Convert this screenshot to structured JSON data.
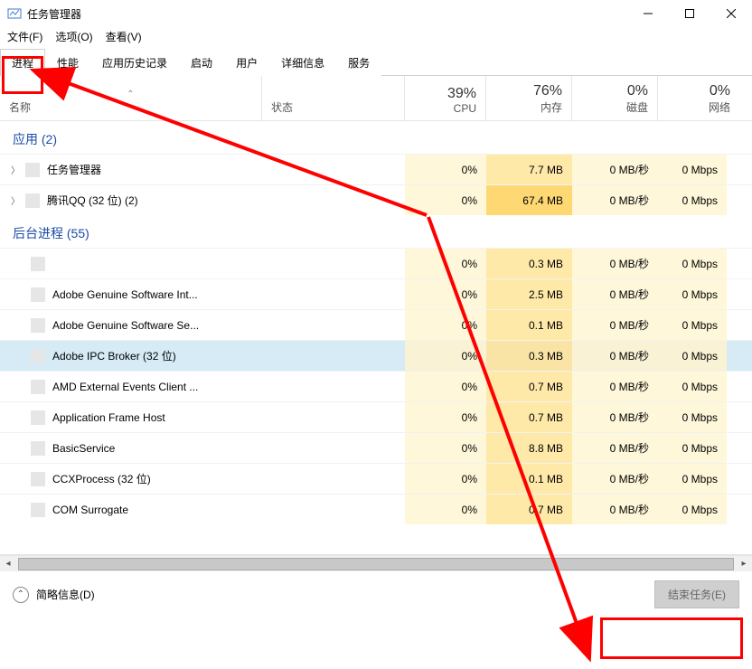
{
  "window": {
    "title": "任务管理器"
  },
  "menu": {
    "file": "文件(F)",
    "options": "选项(O)",
    "view": "查看(V)"
  },
  "tabs": [
    {
      "label": "进程",
      "active": true
    },
    {
      "label": "性能",
      "active": false
    },
    {
      "label": "应用历史记录",
      "active": false
    },
    {
      "label": "启动",
      "active": false
    },
    {
      "label": "用户",
      "active": false
    },
    {
      "label": "详细信息",
      "active": false
    },
    {
      "label": "服务",
      "active": false
    }
  ],
  "columns": {
    "name": "名称",
    "state": "状态",
    "cpu_pct": "39%",
    "cpu_lbl": "CPU",
    "mem_pct": "76%",
    "mem_lbl": "内存",
    "dsk_pct": "0%",
    "dsk_lbl": "磁盘",
    "net_pct": "0%",
    "net_lbl": "网络"
  },
  "groups": {
    "apps": "应用 (2)",
    "bg": "后台进程 (55)"
  },
  "rows": {
    "r0": {
      "name": "任务管理器",
      "cpu": "0%",
      "mem": "7.7 MB",
      "dsk": "0 MB/秒",
      "net": "0 Mbps",
      "exp": true,
      "memdark": false
    },
    "r1": {
      "name": "腾讯QQ (32 位) (2)",
      "cpu": "0%",
      "mem": "67.4 MB",
      "dsk": "0 MB/秒",
      "net": "0 Mbps",
      "exp": true,
      "memdark": true
    },
    "r2": {
      "name": "",
      "cpu": "0%",
      "mem": "0.3 MB",
      "dsk": "0 MB/秒",
      "net": "0 Mbps",
      "exp": false,
      "memdark": false
    },
    "r3": {
      "name": "Adobe Genuine Software Int...",
      "cpu": "0%",
      "mem": "2.5 MB",
      "dsk": "0 MB/秒",
      "net": "0 Mbps",
      "exp": false,
      "memdark": false
    },
    "r4": {
      "name": "Adobe Genuine Software Se...",
      "cpu": "0%",
      "mem": "0.1 MB",
      "dsk": "0 MB/秒",
      "net": "0 Mbps",
      "exp": false,
      "memdark": false
    },
    "r5": {
      "name": "Adobe IPC Broker (32 位)",
      "cpu": "0%",
      "mem": "0.3 MB",
      "dsk": "0 MB/秒",
      "net": "0 Mbps",
      "exp": false,
      "memdark": false,
      "selected": true
    },
    "r6": {
      "name": "AMD External Events Client ...",
      "cpu": "0%",
      "mem": "0.7 MB",
      "dsk": "0 MB/秒",
      "net": "0 Mbps",
      "exp": false,
      "memdark": false
    },
    "r7": {
      "name": "Application Frame Host",
      "cpu": "0%",
      "mem": "0.7 MB",
      "dsk": "0 MB/秒",
      "net": "0 Mbps",
      "exp": false,
      "memdark": false
    },
    "r8": {
      "name": "BasicService",
      "cpu": "0%",
      "mem": "8.8 MB",
      "dsk": "0 MB/秒",
      "net": "0 Mbps",
      "exp": false,
      "memdark": false
    },
    "r9": {
      "name": "CCXProcess (32 位)",
      "cpu": "0%",
      "mem": "0.1 MB",
      "dsk": "0 MB/秒",
      "net": "0 Mbps",
      "exp": false,
      "memdark": false
    },
    "r10": {
      "name": "COM Surrogate",
      "cpu": "0%",
      "mem": "0.7 MB",
      "dsk": "0 MB/秒",
      "net": "0 Mbps",
      "exp": false,
      "memdark": false
    }
  },
  "footer": {
    "fewer": "简略信息(D)",
    "end": "结束任务(E)"
  }
}
